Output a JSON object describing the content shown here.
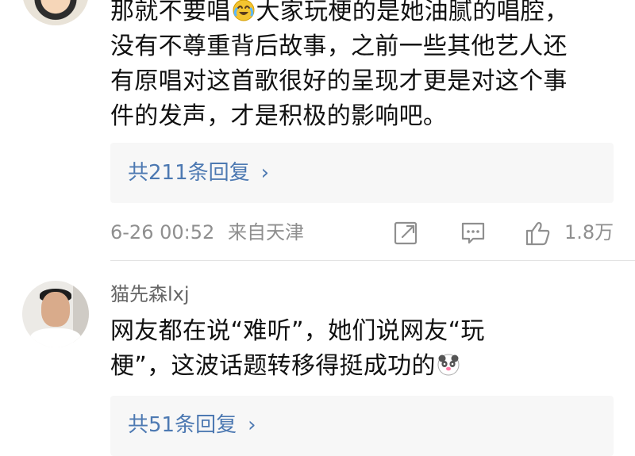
{
  "comments": [
    {
      "text_lines": [
        "那就不要唱",
        "大家玩梗的是她油腻的唱腔，",
        "没有不尊重背后故事，之前一些其他艺人还",
        "有原唱对这首歌很好的呈现才更是对这个事",
        "件的发声，才是积极的影响吧。"
      ],
      "reply_label": "共211条回复",
      "time": "6-26 00:52",
      "location": "来自天津",
      "likes": "1.8万"
    },
    {
      "username": "猫先森lxj",
      "text_lines": [
        "网友都在说“难听”，她们说网友“玩",
        "梗”，这波话题转移得挺成功的"
      ],
      "reply_label": "共51条回复"
    }
  ],
  "icons": {
    "share": "share-icon",
    "comment": "comment-icon",
    "like": "thumbs-up-icon",
    "chevron": "chevron-right-icon",
    "emoji_1": "crying-laughing-emoji-icon",
    "emoji_2": "panda-emoji-icon"
  },
  "colors": {
    "link": "#4d79b2",
    "meta": "#8f8f8f",
    "text": "#111111"
  }
}
